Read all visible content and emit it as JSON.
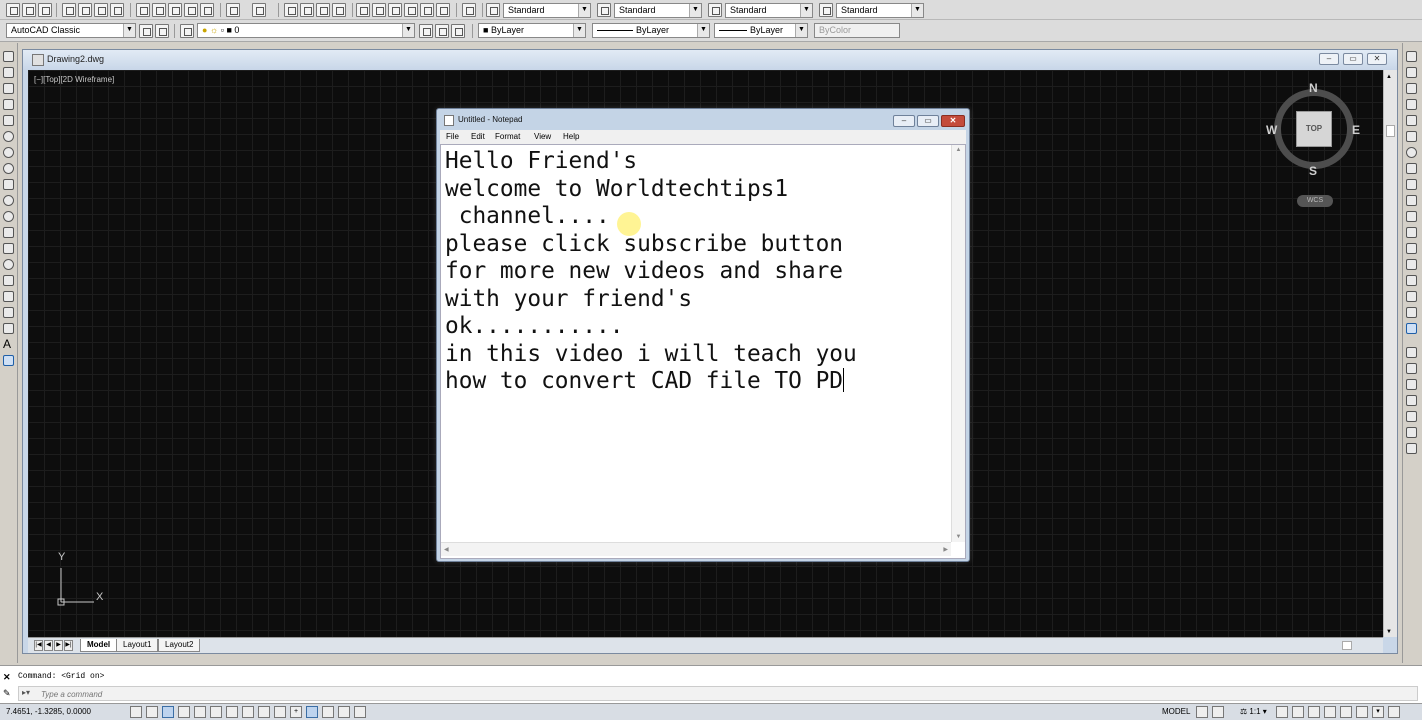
{
  "toolbar": {
    "text_style": "Standard",
    "dim_style": "Standard",
    "table_style": "Standard",
    "multileader_style": "Standard",
    "workspace": "AutoCAD Classic",
    "layer": "0",
    "color": "ByLayer",
    "linetype": "ByLayer",
    "lineweight": "ByLayer",
    "plot_style": "ByColor"
  },
  "document": {
    "title": "Drawing2.dwg",
    "viewport_label": "[−][Top][2D Wireframe]",
    "tabs": [
      "Model",
      "Layout1",
      "Layout2"
    ],
    "active_tab": "Model"
  },
  "viewcube": {
    "north": "N",
    "south": "S",
    "east": "E",
    "west": "W",
    "face": "TOP",
    "coord_system": "WCS"
  },
  "ucs": {
    "y": "Y",
    "x": "X"
  },
  "notepad": {
    "title": "Untitled - Notepad",
    "menu": [
      "File",
      "Edit",
      "Format",
      "View",
      "Help"
    ],
    "lines": [
      "Hello Friend's",
      "welcome to Worldtechtips1",
      " channel....",
      "please click subscribe button",
      "for more new videos and share",
      "with your friend's",
      "ok...........",
      "in this video i will teach you",
      "how to convert CAD file TO PD"
    ]
  },
  "command": {
    "history": "Command:  <Grid on>",
    "placeholder": "Type a command"
  },
  "status": {
    "coords": "7.4651, -1.3285, 0.0000",
    "mode": "MODEL",
    "scale": "1:1"
  },
  "colors": {
    "canvas": "#0d0d0d",
    "grid": "#1d1d1d",
    "title_bar": "#c8d6e8",
    "close_button": "#c44b3b"
  }
}
